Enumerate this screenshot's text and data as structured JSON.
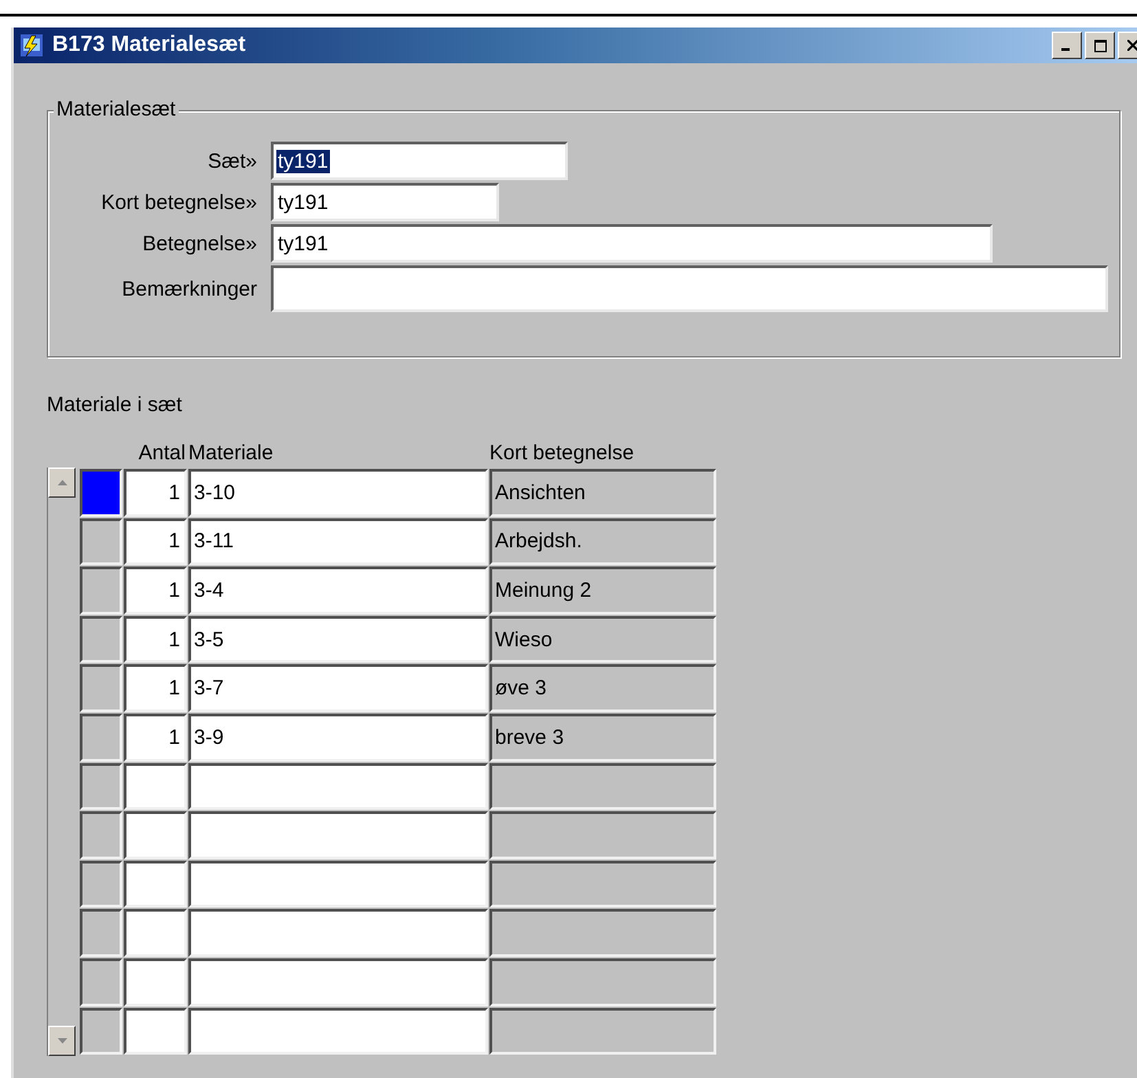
{
  "window": {
    "title": "B173 Materialesæt"
  },
  "group": {
    "legend": "Materialesæt",
    "fields": [
      {
        "label": "Sæt»",
        "value": "ty191",
        "text_selected": true
      },
      {
        "label": "Kort betegnelse»",
        "value": "ty191",
        "text_selected": false
      },
      {
        "label": "Betegnelse»",
        "value": "ty191",
        "text_selected": false
      },
      {
        "label": "Bemærkninger"
      }
    ]
  },
  "table": {
    "title": "Materiale i sæt",
    "columns": [
      "Antal",
      "Materiale",
      "Kort betegnelse"
    ],
    "rows": [
      {
        "selected": true,
        "antal": "1",
        "materiale": "3-10",
        "kort": "Ansichten"
      },
      {
        "selected": false,
        "antal": "1",
        "materiale": "3-11",
        "kort": "Arbejdsh."
      },
      {
        "selected": false,
        "antal": "1",
        "materiale": "3-4",
        "kort": "Meinung 2"
      },
      {
        "selected": false,
        "antal": "1",
        "materiale": "3-5",
        "kort": "Wieso"
      },
      {
        "selected": false,
        "antal": "1",
        "materiale": "3-7",
        "kort": "øve 3"
      },
      {
        "selected": false,
        "antal": "1",
        "materiale": "3-9",
        "kort": "breve 3"
      },
      {
        "selected": false
      },
      {
        "selected": false
      },
      {
        "selected": false
      },
      {
        "selected": false
      },
      {
        "selected": false
      },
      {
        "selected": false
      }
    ]
  }
}
